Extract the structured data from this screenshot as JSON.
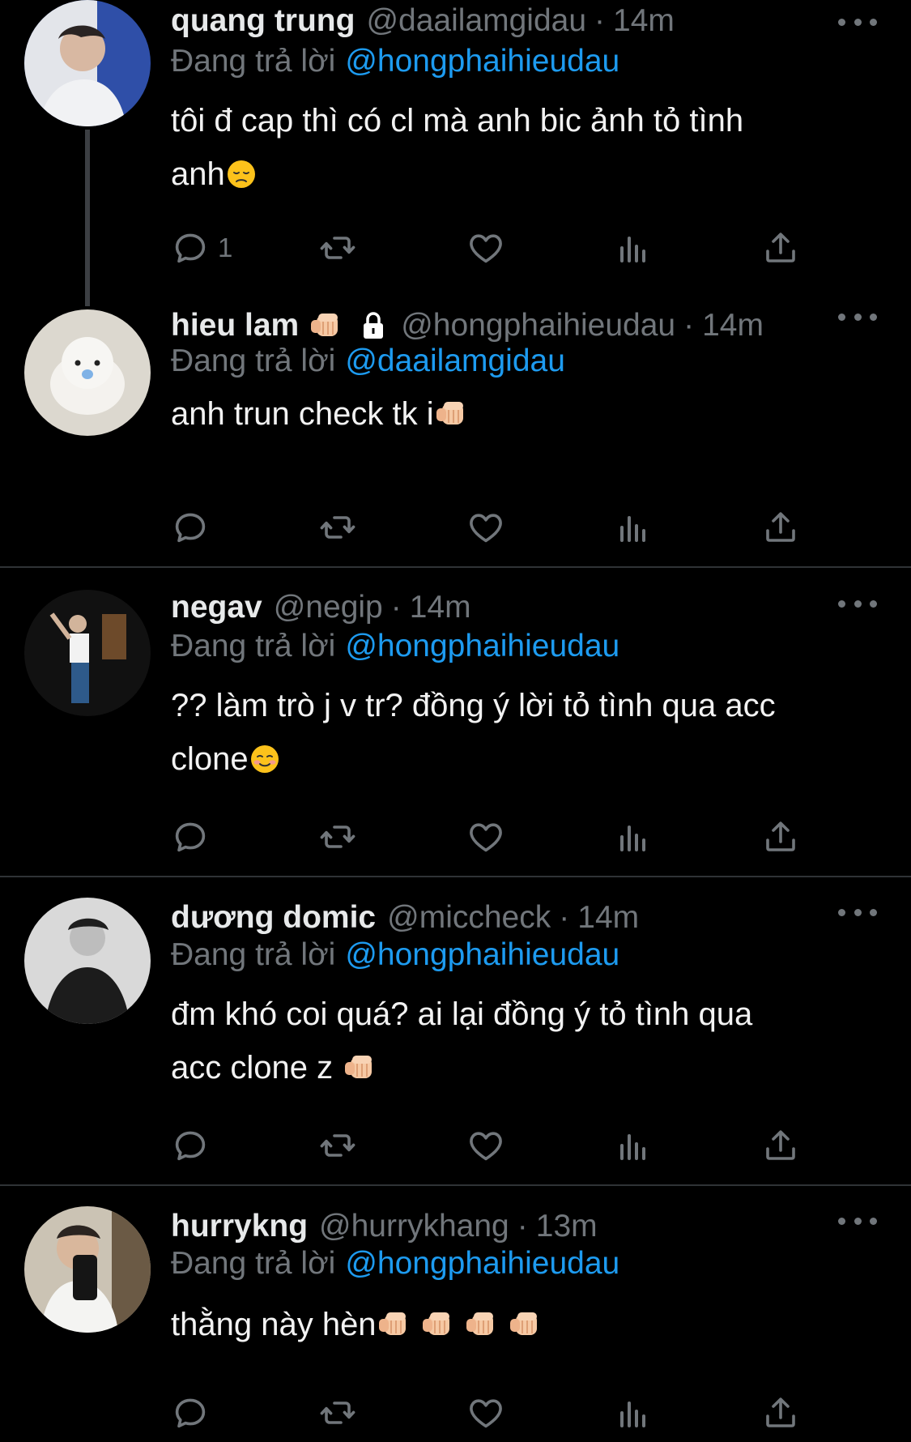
{
  "replying_label": "Đang trả lời",
  "tweets": [
    {
      "name": "quang trung",
      "handle": "@daailamgidau",
      "separator": "·",
      "time": "14m",
      "reply_to": "@hongphaihieudau",
      "line1": "tôi đ cap thì có cl mà anh bic ảnh tỏ tình",
      "line2": "anh",
      "reply_count": "1",
      "emoji": "disappointed-face"
    },
    {
      "name": "hieu lam",
      "handle": "@hongphaihieudau",
      "separator": "·",
      "time": "14m",
      "reply_to": "@daailamgidau",
      "line1": "anh trun check tk i",
      "emoji": "oncoming-fist"
    },
    {
      "name": "negav",
      "handle": "@negip",
      "separator": "·",
      "time": "14m",
      "reply_to": "@hongphaihieudau",
      "line1": "?? làm trò j v tr? đồng ý lời tỏ tình qua acc",
      "line2": "clone",
      "emoji": "smiling-face"
    },
    {
      "name": "dương domic",
      "handle": "@miccheck",
      "separator": "·",
      "time": "14m",
      "reply_to": "@hongphaihieudau",
      "line1": "đm khó coi quá? ai lại đồng ý tỏ tình qua",
      "line2": "acc clone z",
      "emoji": "oncoming-fist"
    },
    {
      "name": "hurrykng",
      "handle": "@hurrykhang",
      "separator": "·",
      "time": "13m",
      "reply_to": "@hongphaihieudau",
      "line1": "thằng này hèn",
      "emoji": "oncoming-fist"
    }
  ],
  "colors": {
    "background": "#000000",
    "text": "#e7e9ea",
    "muted": "#71767b",
    "mention": "#1d9bf0",
    "divider": "#2f3336"
  },
  "icons": [
    "reply-icon",
    "retweet-icon",
    "like-icon",
    "views-icon",
    "share-icon",
    "more-icon",
    "lock-icon"
  ]
}
